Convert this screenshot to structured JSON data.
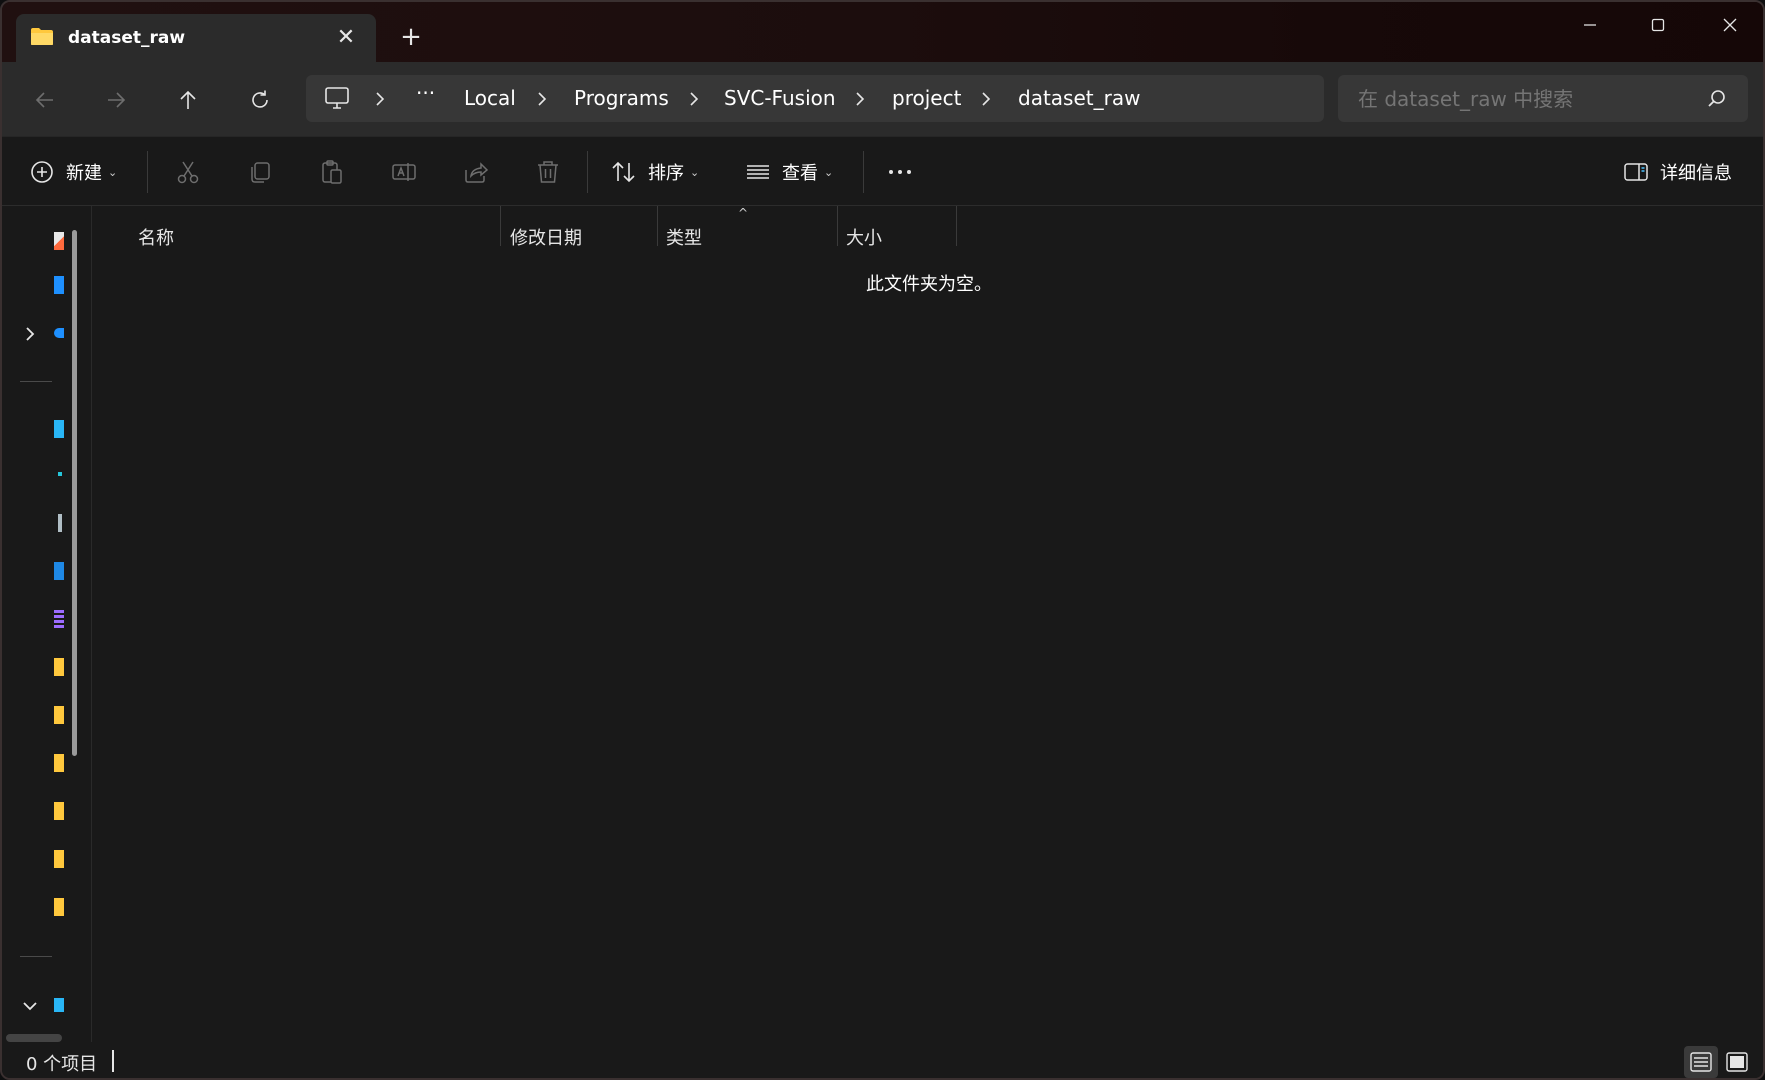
{
  "tab": {
    "title": "dataset_raw",
    "close_glyph": "✕",
    "new_tab_glyph": "+"
  },
  "window_controls": [
    "minimize-icon",
    "maximize-icon",
    "close-icon"
  ],
  "nav": {
    "back": "arrow-left-icon",
    "forward": "arrow-right-icon",
    "up": "arrow-up-icon",
    "refresh": "refresh-icon"
  },
  "address": {
    "root_icon": "computer-icon",
    "overflow": "···",
    "crumbs": [
      "Local",
      "Programs",
      "SVC-Fusion",
      "project",
      "dataset_raw"
    ]
  },
  "search": {
    "placeholder": "在 dataset_raw 中搜索"
  },
  "toolbar": {
    "new_label": "新建",
    "sort_label": "排序",
    "view_label": "查看",
    "more_glyph": "•••",
    "details_label": "详细信息",
    "icons": [
      "cut-icon",
      "copy-icon",
      "paste-icon",
      "rename-icon",
      "share-icon",
      "delete-icon"
    ]
  },
  "columns": [
    "名称",
    "修改日期",
    "类型",
    "大小"
  ],
  "sort_indicator": "^",
  "empty_message": "此文件夹为空。",
  "status": {
    "item_count": "0 个项目"
  },
  "colors": {
    "accent": "#4cc2ff",
    "folder": "#ffc83d",
    "background": "#191919",
    "toolbar": "#2b2b2b"
  }
}
